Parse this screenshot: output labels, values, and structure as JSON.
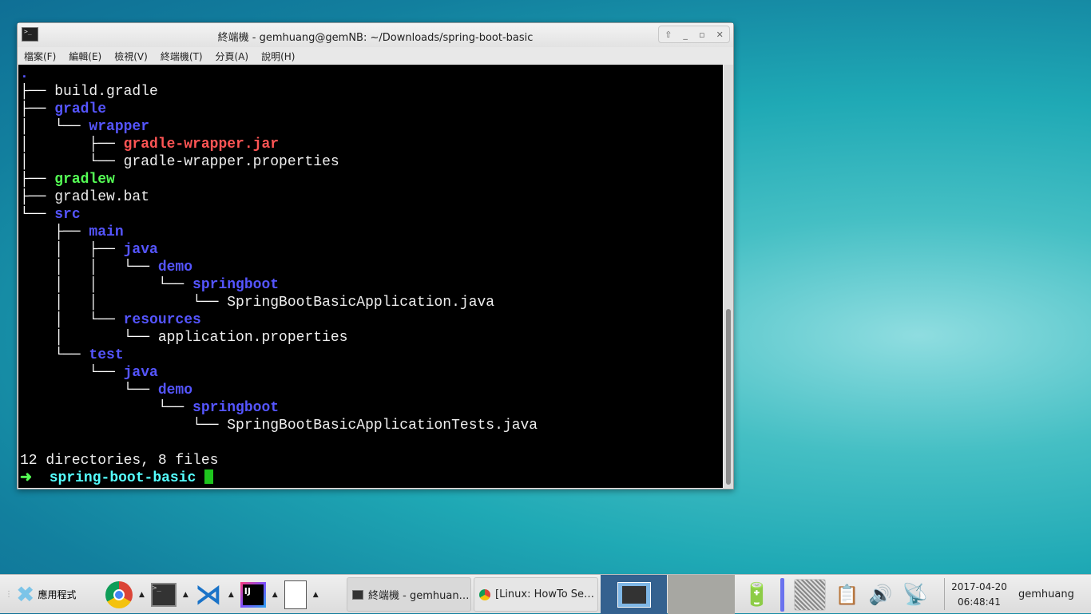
{
  "window": {
    "title": "終端機 - gemhuang@gemNB: ~/Downloads/spring-boot-basic",
    "menu": [
      "檔案(F)",
      "編輯(E)",
      "檢視(V)",
      "終端機(T)",
      "分頁(A)",
      "說明(H)"
    ]
  },
  "colors": {
    "dir": "#5555ff",
    "exec": "#55ff55",
    "archive": "#ff5555",
    "file": "#eeeeee",
    "prompt_dir": "#55ffff",
    "cursor": "#1ec51e"
  },
  "terminal": {
    "lines": [
      {
        "prefix": "",
        "name": ".",
        "color": "dir"
      },
      {
        "prefix": "├── ",
        "name": "build.gradle",
        "color": "file"
      },
      {
        "prefix": "├── ",
        "name": "gradle",
        "color": "dir"
      },
      {
        "prefix": "│   └── ",
        "name": "wrapper",
        "color": "dir"
      },
      {
        "prefix": "│       ├── ",
        "name": "gradle-wrapper.jar",
        "color": "archive"
      },
      {
        "prefix": "│       └── ",
        "name": "gradle-wrapper.properties",
        "color": "file"
      },
      {
        "prefix": "├── ",
        "name": "gradlew",
        "color": "exec"
      },
      {
        "prefix": "├── ",
        "name": "gradlew.bat",
        "color": "file"
      },
      {
        "prefix": "└── ",
        "name": "src",
        "color": "dir"
      },
      {
        "prefix": "    ├── ",
        "name": "main",
        "color": "dir"
      },
      {
        "prefix": "    │   ├── ",
        "name": "java",
        "color": "dir"
      },
      {
        "prefix": "    │   │   └── ",
        "name": "demo",
        "color": "dir"
      },
      {
        "prefix": "    │   │       └── ",
        "name": "springboot",
        "color": "dir"
      },
      {
        "prefix": "    │   │           └── ",
        "name": "SpringBootBasicApplication.java",
        "color": "file"
      },
      {
        "prefix": "    │   └── ",
        "name": "resources",
        "color": "dir"
      },
      {
        "prefix": "    │       └── ",
        "name": "application.properties",
        "color": "file"
      },
      {
        "prefix": "    └── ",
        "name": "test",
        "color": "dir"
      },
      {
        "prefix": "        └── ",
        "name": "java",
        "color": "dir"
      },
      {
        "prefix": "            └── ",
        "name": "demo",
        "color": "dir"
      },
      {
        "prefix": "                └── ",
        "name": "springboot",
        "color": "dir"
      },
      {
        "prefix": "                    └── ",
        "name": "SpringBootBasicApplicationTests.java",
        "color": "file"
      },
      {
        "prefix": "",
        "name": "",
        "color": "file"
      }
    ],
    "summary": "12 directories, 8 files",
    "prompt_arrow": "➜",
    "prompt_dir": "spring-boot-basic"
  },
  "taskbar": {
    "apps_label": "應用程式",
    "tasks": [
      {
        "label": "終端機 - gemhuan…",
        "icon": "terminal-icon"
      },
      {
        "label": "[Linux: HowTo Se…",
        "icon": "chrome-icon"
      }
    ],
    "date": "2017-04-20",
    "time": "06:48:41",
    "user": "gemhuang"
  }
}
